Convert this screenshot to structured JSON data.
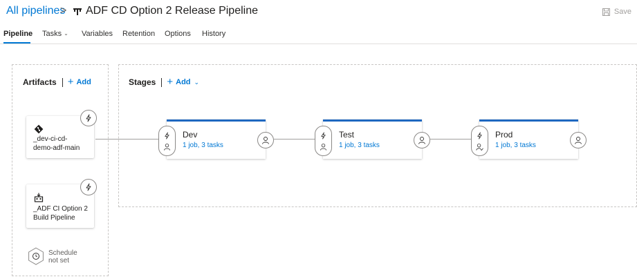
{
  "breadcrumb": {
    "root": "All pipelines",
    "separator": ">",
    "title": "ADF CD Option 2 Release Pipeline"
  },
  "toolbar": {
    "save_label": "Save"
  },
  "tabs": [
    {
      "label": "Pipeline",
      "active": true
    },
    {
      "label": "Tasks",
      "dropdown": true
    },
    {
      "label": "Variables"
    },
    {
      "label": "Retention"
    },
    {
      "label": "Options"
    },
    {
      "label": "History"
    }
  ],
  "artifacts": {
    "title": "Artifacts",
    "add_label": "Add",
    "items": [
      {
        "name_line1": "_dev-ci-cd-",
        "name_line2": "demo-adf-main",
        "icon": "git-icon"
      },
      {
        "name_line1": "_ADF CI Option 2",
        "name_line2": "Build Pipeline",
        "icon": "build-icon"
      }
    ],
    "schedule": {
      "line1": "Schedule",
      "line2": "not set"
    }
  },
  "stages": {
    "title": "Stages",
    "add_label": "Add",
    "items": [
      {
        "name": "Dev",
        "detail": "1 job, 3 tasks"
      },
      {
        "name": "Test",
        "detail": "1 job, 3 tasks"
      },
      {
        "name": "Prod",
        "detail": "1 job, 3 tasks"
      }
    ]
  },
  "colors": {
    "accent": "#0078d4",
    "stage_bar": "#1e67c0",
    "border": "#8a8886"
  }
}
